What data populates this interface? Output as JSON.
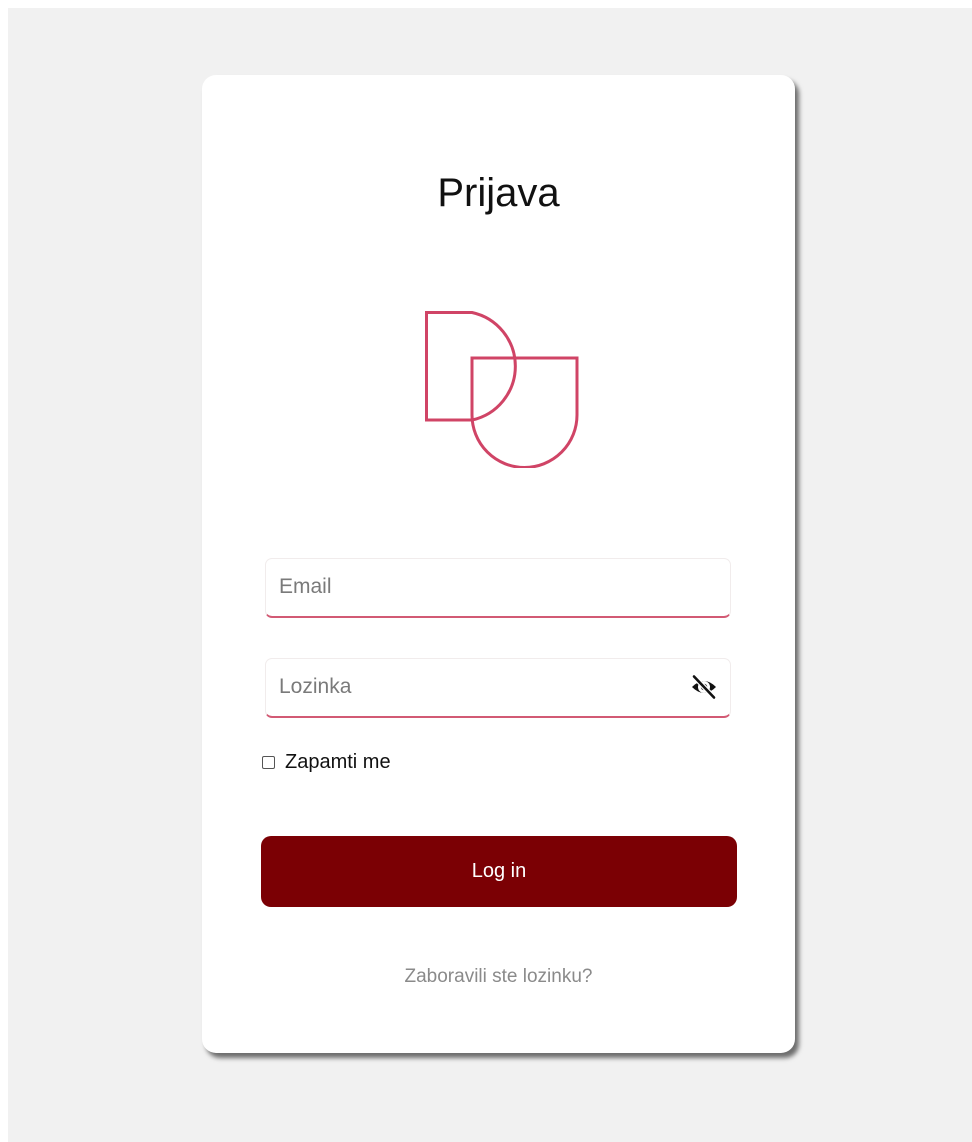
{
  "login": {
    "title": "Prijava",
    "email_placeholder": "Email",
    "password_placeholder": "Lozinka",
    "remember_label": "Zapamti me",
    "remember_checked": false,
    "submit_label": "Log in",
    "forgot_link": "Zaboravili ste lozinku?"
  },
  "icons": {
    "logo": "du-logo",
    "password_toggle": "eye-slash-icon"
  },
  "colors": {
    "background": "#f1f1f1",
    "card": "#ffffff",
    "accent": "#d04466",
    "button": "#7b0004",
    "button_text": "#ffffff",
    "link": "#8a8a8a"
  }
}
